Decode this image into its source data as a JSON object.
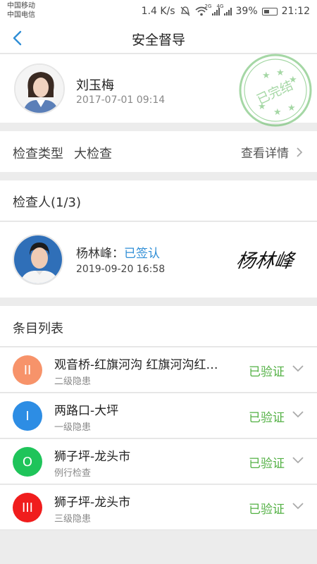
{
  "status_bar": {
    "carrier1": "中国移动",
    "carrier2": "中国电信",
    "speed": "1.4 K/s",
    "net1": "2G",
    "net2": "4G",
    "battery": "39%",
    "time": "21:12"
  },
  "nav": {
    "title": "安全督导"
  },
  "profile": {
    "name": "刘玉梅",
    "datetime": "2017-07-01   09:14",
    "stamp_text": "已完结"
  },
  "inspection": {
    "type_label": "检查类型",
    "type_value": "大检查",
    "detail_link": "查看详情"
  },
  "inspectors": {
    "header": "检查人(1/3)",
    "name": "杨林峰：",
    "status": "已签认",
    "datetime": "2019-09-20 16:58",
    "signature": "杨林峰"
  },
  "items_section": {
    "header": "条目列表",
    "items": [
      {
        "badge": "II",
        "badge_color": "#f7936a",
        "title": "观音桥-红旗河沟  红旗河沟红…",
        "subtitle": "二级隐患",
        "status": "已验证"
      },
      {
        "badge": "I",
        "badge_color": "#2d8de4",
        "title": "两路口-大坪",
        "subtitle": "一级隐患",
        "status": "已验证"
      },
      {
        "badge": "O",
        "badge_color": "#1fc45a",
        "title": "狮子坪-龙头市",
        "subtitle": "例行检查",
        "status": "已验证"
      },
      {
        "badge": "III",
        "badge_color": "#f01d1d",
        "title": "狮子坪-龙头市",
        "subtitle": "三级隐患",
        "status": "已验证"
      }
    ]
  },
  "colors": {
    "accent_blue": "#2f8ed6",
    "verified_green": "#52b043",
    "stamp_green": "#5cb85c"
  }
}
